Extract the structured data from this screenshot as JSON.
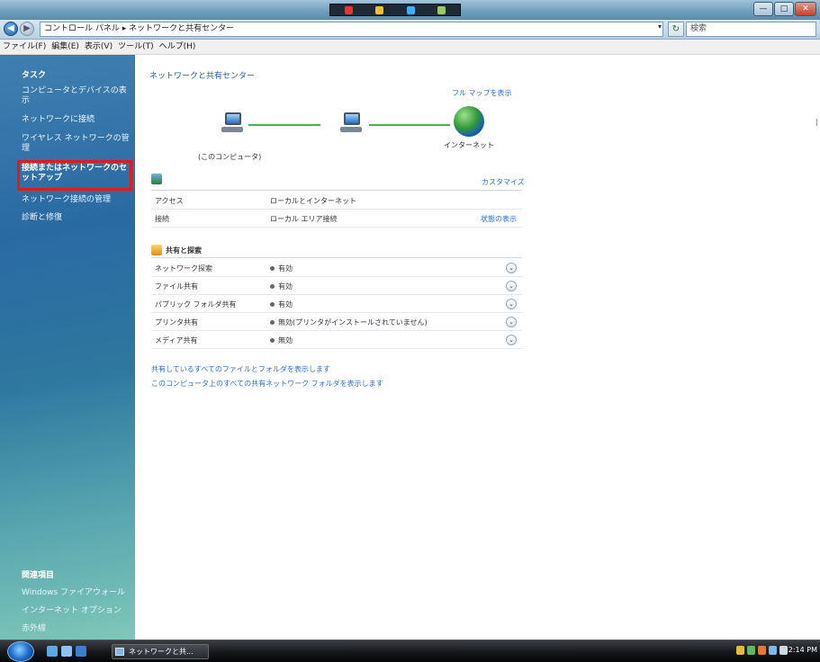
{
  "window": {
    "address": "コントロール パネル ▸ ネットワークと共有センター",
    "search_placeholder": "検索",
    "buttons": {
      "minimize": "—",
      "maximize": "□",
      "close": "✕"
    }
  },
  "menu": [
    "ファイル(F)",
    "編集(E)",
    "表示(V)",
    "ツール(T)",
    "ヘルプ(H)"
  ],
  "sidebar": {
    "tasks_heading": "タスク",
    "tasks": [
      "コンピュータとデバイスの表示",
      "ネットワークに接続",
      "ワイヤレス ネットワークの管理",
      "接続またはネットワークのセットアップ",
      "ネットワーク接続の管理",
      "診断と修復"
    ],
    "related_heading": "関連項目",
    "related": [
      "Windows ファイアウォール",
      "インターネット オプション",
      "赤外線"
    ]
  },
  "main": {
    "title": "ネットワークと共有センター",
    "full_map": "フル マップを表示",
    "this_computer": "(このコンピュータ)",
    "internet": "インターネット",
    "customize": "カスタマイズ",
    "network_rows": [
      {
        "key": "アクセス",
        "value": "ローカルとインターネット",
        "action": ""
      },
      {
        "key": "接続",
        "value": "ローカル エリア接続",
        "action": "状態の表示"
      }
    ],
    "sharing_heading": "共有と探索",
    "sharing_rows": [
      {
        "key": "ネットワーク探索",
        "value": "有効"
      },
      {
        "key": "ファイル共有",
        "value": "有効"
      },
      {
        "key": "パブリック フォルダ共有",
        "value": "有効"
      },
      {
        "key": "プリンタ共有",
        "value": "無効(プリンタがインストールされていません)"
      },
      {
        "key": "メディア共有",
        "value": "無効"
      }
    ],
    "links": [
      "共有しているすべてのファイルとフォルダを表示します",
      "このコンピュータ上のすべての共有ネットワーク フォルダを表示します"
    ]
  },
  "taskbar": {
    "task": "ネットワークと共...",
    "clock": "2:14 PM"
  },
  "colors": {
    "highlight_box": "#e31a1a",
    "link": "#2a6fcf",
    "sidebar_top": "#3f7fb0",
    "sidebar_bottom": "#7fc7b8"
  }
}
